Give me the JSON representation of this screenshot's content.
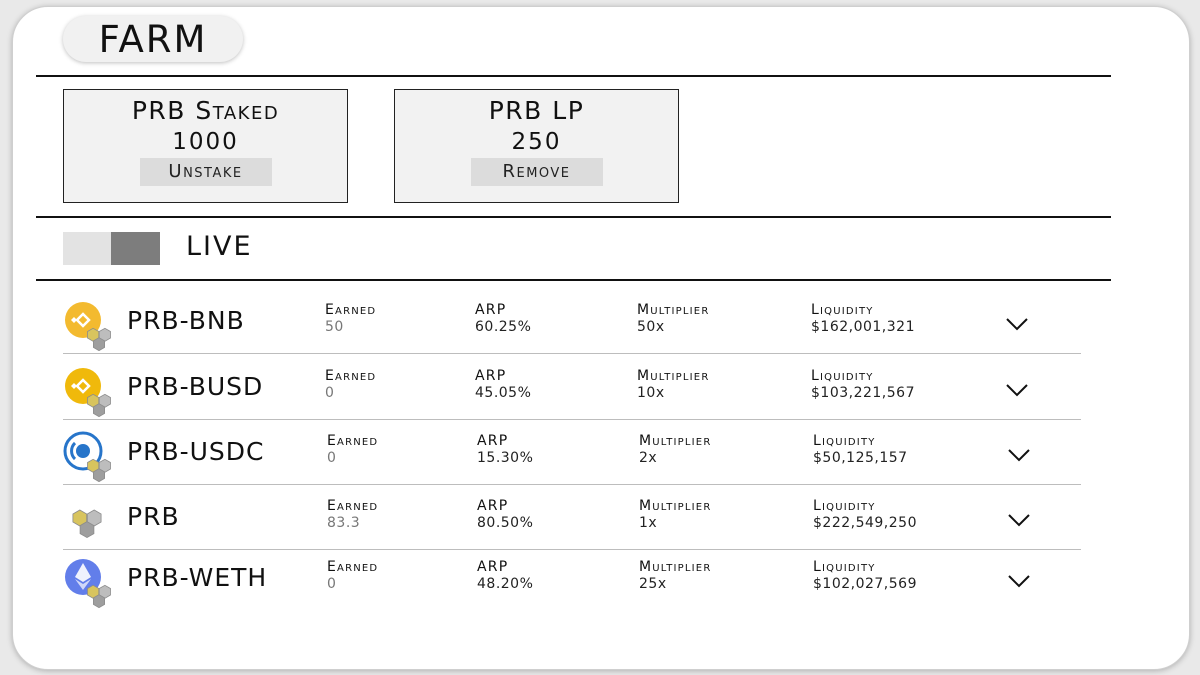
{
  "header": {
    "title": "FARM"
  },
  "stats": [
    {
      "title": "PRB Staked",
      "value": "1000",
      "button": "Unstake"
    },
    {
      "title": "PRB LP",
      "value": "250",
      "button": "Remove"
    }
  ],
  "filter": {
    "label": "LIVE",
    "toggle_on": true
  },
  "column_labels": {
    "earned": "Earned",
    "apr": "ARP",
    "multiplier": "Multiplier",
    "liquidity": "Liquidity"
  },
  "farms": [
    {
      "pair": "PRB-BNB",
      "icon": "bnb-icon",
      "earned": "50",
      "apr": "60.25%",
      "multiplier": "50x",
      "liquidity": "$162,001,321"
    },
    {
      "pair": "PRB-BUSD",
      "icon": "busd-icon",
      "earned": "0",
      "apr": "45.05%",
      "multiplier": "10x",
      "liquidity": "$103,221,567"
    },
    {
      "pair": "PRB-USDC",
      "icon": "usdc-icon",
      "earned": "0",
      "apr": "15.30%",
      "multiplier": "2x",
      "liquidity": "$50,125,157"
    },
    {
      "pair": "PRB",
      "icon": "prb-icon",
      "earned": "83.3",
      "apr": "80.50%",
      "multiplier": "1x",
      "liquidity": "$222,549,250"
    },
    {
      "pair": "PRB-WETH",
      "icon": "eth-icon",
      "earned": "0",
      "apr": "48.20%",
      "multiplier": "25x",
      "liquidity": "$102,027,569"
    }
  ],
  "colors": {
    "bnb": "#f3ba2f",
    "busd": "#f0b90b",
    "usdc": "#2775ca",
    "eth": "#627eea",
    "prb": "#c9b458",
    "toggle_dark": "#7d7d7d",
    "toggle_light": "#e3e3e3"
  }
}
